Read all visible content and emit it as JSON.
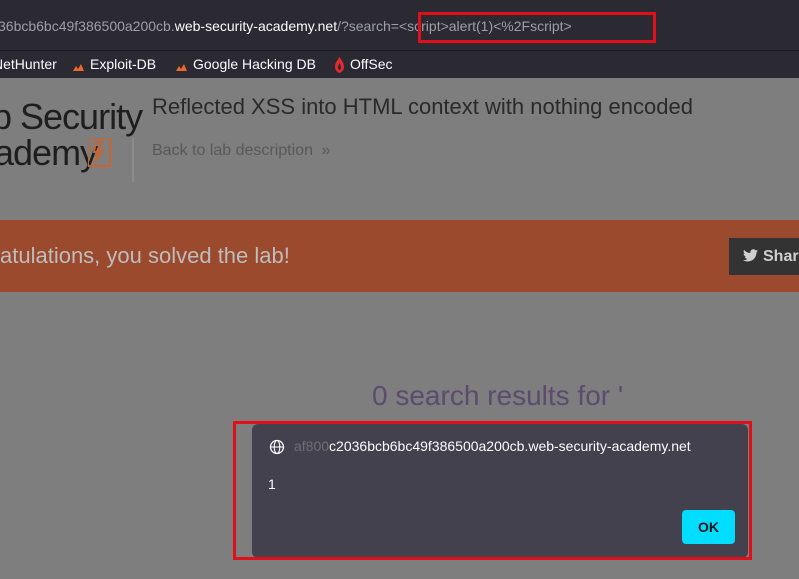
{
  "address_bar": {
    "url_prefix": "36bcb6bc49f386500a200cb.",
    "url_host": "web-security-academy.net",
    "url_path": "/?search=<script>alert(1)<%2Fscript>"
  },
  "bookmarks": [
    {
      "label": "NetHunter",
      "icon": "kali-dragon-icon"
    },
    {
      "label": "Exploit-DB",
      "icon": "exploit-db-icon"
    },
    {
      "label": "Google Hacking DB",
      "icon": "ghdb-icon"
    },
    {
      "label": "OffSec",
      "icon": "offsec-icon"
    }
  ],
  "header": {
    "logo_line1": "b Security",
    "logo_line2": "ademy",
    "lab_title": "Reflected XSS into HTML context with nothing encoded",
    "back_link": "Back to lab description",
    "back_chevron": "»"
  },
  "banner": {
    "message": "atulations, you solved the lab!",
    "share_label": "Shar"
  },
  "search": {
    "heading": "0 search results for '"
  },
  "alert_dialog": {
    "origin_faint": "af800",
    "origin": "c2036bcb6bc49f386500a200cb.web-security-academy.net",
    "message": "1",
    "ok_label": "OK"
  },
  "colors": {
    "highlight": "#e0101a",
    "ok_button": "#00ddff",
    "banner": "#9c4a2d"
  }
}
